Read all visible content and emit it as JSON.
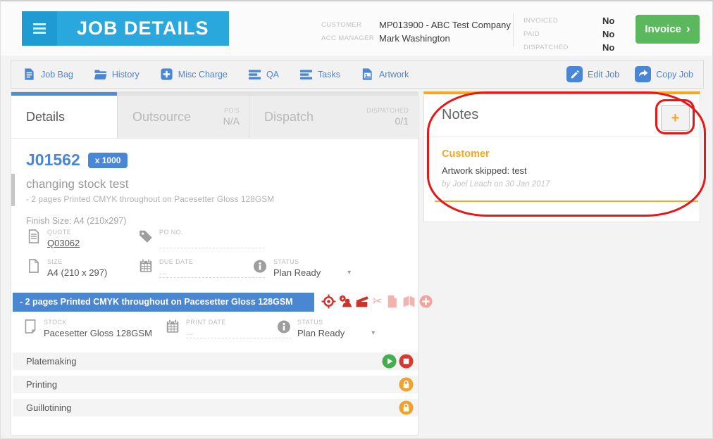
{
  "ui": {
    "caret": "▾",
    "chevron": "›",
    "plus": "+",
    "scissors_glyph": "✂"
  },
  "header": {
    "title": "JOB DETAILS",
    "customer_label": "CUSTOMER",
    "customer_value": "MP013900 - ABC Test Company",
    "acc_manager_label": "ACC MANAGER",
    "acc_manager_value": "Mark Washington",
    "flags": [
      {
        "label": "INVOICED",
        "value": "No"
      },
      {
        "label": "PAID",
        "value": "No"
      },
      {
        "label": "DISPATCHED",
        "value": "No"
      }
    ],
    "invoice_label": "Invoice"
  },
  "toolbar": {
    "items": [
      {
        "label": "Job Bag"
      },
      {
        "label": "History"
      },
      {
        "label": "Misc Charge"
      },
      {
        "label": "QA"
      },
      {
        "label": "Tasks"
      },
      {
        "label": "Artwork"
      }
    ],
    "edit_label": "Edit Job",
    "copy_label": "Copy Job"
  },
  "tabs": [
    {
      "label": "Details"
    },
    {
      "label": "Outsource",
      "sub_label": "PO'S",
      "sub_value": "N/A"
    },
    {
      "label": "Dispatch",
      "sub_label": "DISPATCHED",
      "sub_value": "0/1"
    }
  ],
  "job": {
    "number": "J01562",
    "quantity_badge": "x 1000",
    "title": "changing stock test",
    "description": "- 2 pages Printed CMYK throughout on Pacesetter Gloss 128GSM",
    "finish_size": "Finish Size: A4 (210x297)",
    "fields": {
      "quote_label": "QUOTE",
      "quote_value": "Q03062",
      "po_label": "PO NO.",
      "po_value": "",
      "size_label": "SIZE",
      "size_value": "A4 (210 x 297)",
      "due_label": "DUE DATE",
      "due_value": "...",
      "status_label": "STATUS",
      "status_value": "Plan Ready"
    },
    "section_bar": "- 2 pages Printed CMYK throughout on Pacesetter Gloss 128GSM",
    "stock": {
      "stock_label": "STOCK",
      "stock_value": "Pacesetter Gloss 128GSM",
      "print_label": "PRINT DATE",
      "print_value": "...",
      "status_label": "STATUS",
      "status_value": "Plan Ready"
    },
    "processes": [
      {
        "name": "Platemaking"
      },
      {
        "name": "Printing"
      },
      {
        "name": "Guillotining"
      }
    ]
  },
  "notes": {
    "title": "Notes",
    "entries": [
      {
        "category": "Customer",
        "text": "Artwork skipped: test",
        "byline": "by Joel Leach on 30 Jan 2017"
      }
    ]
  },
  "colors": {
    "header_blue": "#29a8de",
    "accent_blue": "#4a86d8",
    "invoice_green": "#5cb85c",
    "orange": "#f5a623",
    "process_red": "#cf3229",
    "annotation_red": "#e81717"
  }
}
